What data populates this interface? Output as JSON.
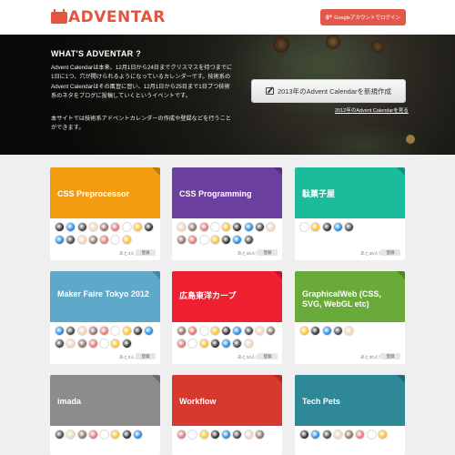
{
  "header": {
    "logo_text": "ADVENTAR",
    "login_label": "Googleアカウントでログイン",
    "login_icon": "g-plus-icon"
  },
  "hero": {
    "title": "WHAT'S ADVENTAR ?",
    "description": "Advent Calendarは本来、12月1日から24日までクリスマスを待つまでに1日に1つ、穴が開けられるようになっているカレンダーです。技術系のAdvent Calendarはその風習に習い、12月1日から25日まで1日ブつ技術系のネタをブログに投稿していくというイベントです。",
    "description2": "本サイトでは技術系アドベントカレンダーの作成や登録などを行うことができます。",
    "create_label": "2013年のAdvent Calendarを新規作成",
    "see_link": "2012年のAdvent Calendarを見る"
  },
  "colors": {
    "brand": "#e4553f",
    "orange": "#f39c12",
    "purple": "#6b3fa0",
    "teal": "#1abc9c",
    "blue": "#5fa8c9",
    "red": "#ee1f2f",
    "green": "#6aaa3a",
    "gray": "#8c8c8c",
    "crimson": "#d63a2f",
    "darkteal": "#2e8896"
  },
  "cards": [
    {
      "title": "CSS Preprocessor",
      "remain": "あと3人！",
      "register": "登録",
      "avatar_count": 16
    },
    {
      "title": "CSS Programming",
      "remain": "あと10人！",
      "register": "登録",
      "avatar_count": 16
    },
    {
      "title": "駄菓子屋",
      "remain": "あと20人！",
      "register": "登録",
      "avatar_count": 5
    },
    {
      "title": "Maker Faire Tokyo 2012",
      "remain": "あと3人！",
      "register": "登録",
      "avatar_count": 16
    },
    {
      "title": "広島東洋カープ",
      "remain": "あと10人！",
      "register": "登録",
      "avatar_count": 16
    },
    {
      "title": "GraphicalWeb (CSS, SVG, WebGL etc)",
      "remain": "あと20人！",
      "register": "登録",
      "avatar_count": 5
    },
    {
      "title": "imada",
      "remain": "",
      "register": "",
      "avatar_count": 8
    },
    {
      "title": "Workflow",
      "remain": "",
      "register": "",
      "avatar_count": 8
    },
    {
      "title": "Tech Pets",
      "remain": "",
      "register": "",
      "avatar_count": 8
    }
  ]
}
